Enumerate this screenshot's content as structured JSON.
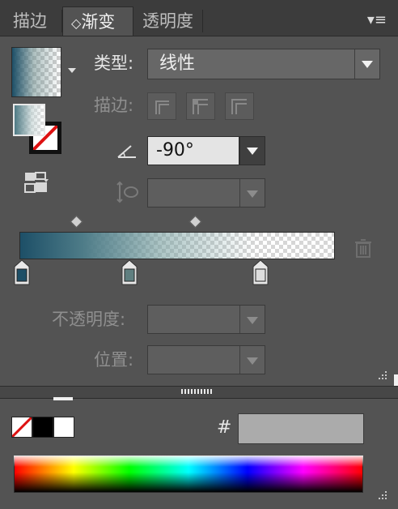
{
  "tabs": [
    {
      "label": "描边",
      "active": false
    },
    {
      "label": "渐变",
      "active": true,
      "prefix": "◇"
    },
    {
      "label": "透明度",
      "active": false
    }
  ],
  "menu_icon": "panel-menu-icon",
  "type": {
    "label": "类型:",
    "value": "线性"
  },
  "stroke": {
    "label": "描边:"
  },
  "angle": {
    "value": "-90°",
    "icon": "angle-icon"
  },
  "aspect": {
    "icon": "aspect-ratio-icon",
    "value": ""
  },
  "gradient": {
    "start_color": "#1d4f67",
    "end_color": "#ffffff",
    "stops": [
      {
        "position": 0,
        "color": "#1d4f67",
        "selected": false
      },
      {
        "position": 0.35,
        "color": "#5f7f80",
        "selected": false
      },
      {
        "position": 0.76,
        "color": "#dddddd",
        "selected": false
      }
    ],
    "midpoints": [
      0.18,
      0.55
    ]
  },
  "opacity": {
    "label": "不透明度:",
    "value": ""
  },
  "location": {
    "label": "位置:",
    "value": ""
  },
  "color": {
    "hex_label": "#",
    "hex_value": "",
    "spectrum_colors": [
      "#ff0000",
      "#ffff00",
      "#00ff00",
      "#00ffff",
      "#0000ff",
      "#ff00ff",
      "#ff0000"
    ]
  }
}
